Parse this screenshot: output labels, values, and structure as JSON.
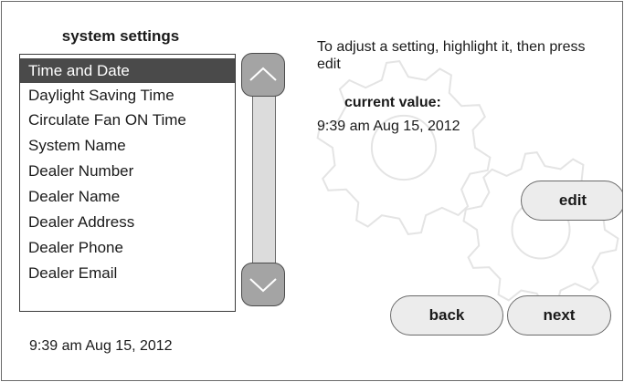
{
  "settings_panel": {
    "title": "system settings",
    "items": [
      {
        "label": "Time and Date",
        "selected": true
      },
      {
        "label": "Daylight Saving Time",
        "selected": false
      },
      {
        "label": "Circulate Fan ON Time",
        "selected": false
      },
      {
        "label": "System Name",
        "selected": false
      },
      {
        "label": "Dealer Number",
        "selected": false
      },
      {
        "label": "Dealer Name",
        "selected": false
      },
      {
        "label": "Dealer Address",
        "selected": false
      },
      {
        "label": "Dealer Phone",
        "selected": false
      },
      {
        "label": "Dealer Email",
        "selected": false
      }
    ]
  },
  "scrollbar": {
    "up_icon": "chevron-up-icon",
    "down_icon": "chevron-down-icon"
  },
  "detail": {
    "instructions": "To adjust a setting, highlight it, then press edit",
    "current_label": "current value:",
    "current_value": "9:39 am Aug 15, 2012"
  },
  "buttons": {
    "edit": "edit",
    "back": "back",
    "next": "next"
  },
  "footer": {
    "time": "9:39 am Aug 15, 2012"
  },
  "colors": {
    "selected_bg": "#4a4a4a",
    "button_bg": "#ececec",
    "scroll_button_bg": "#a4a4a4",
    "scroll_track_bg": "#dcdcdc"
  },
  "icons": {
    "background": "gear-icon"
  }
}
